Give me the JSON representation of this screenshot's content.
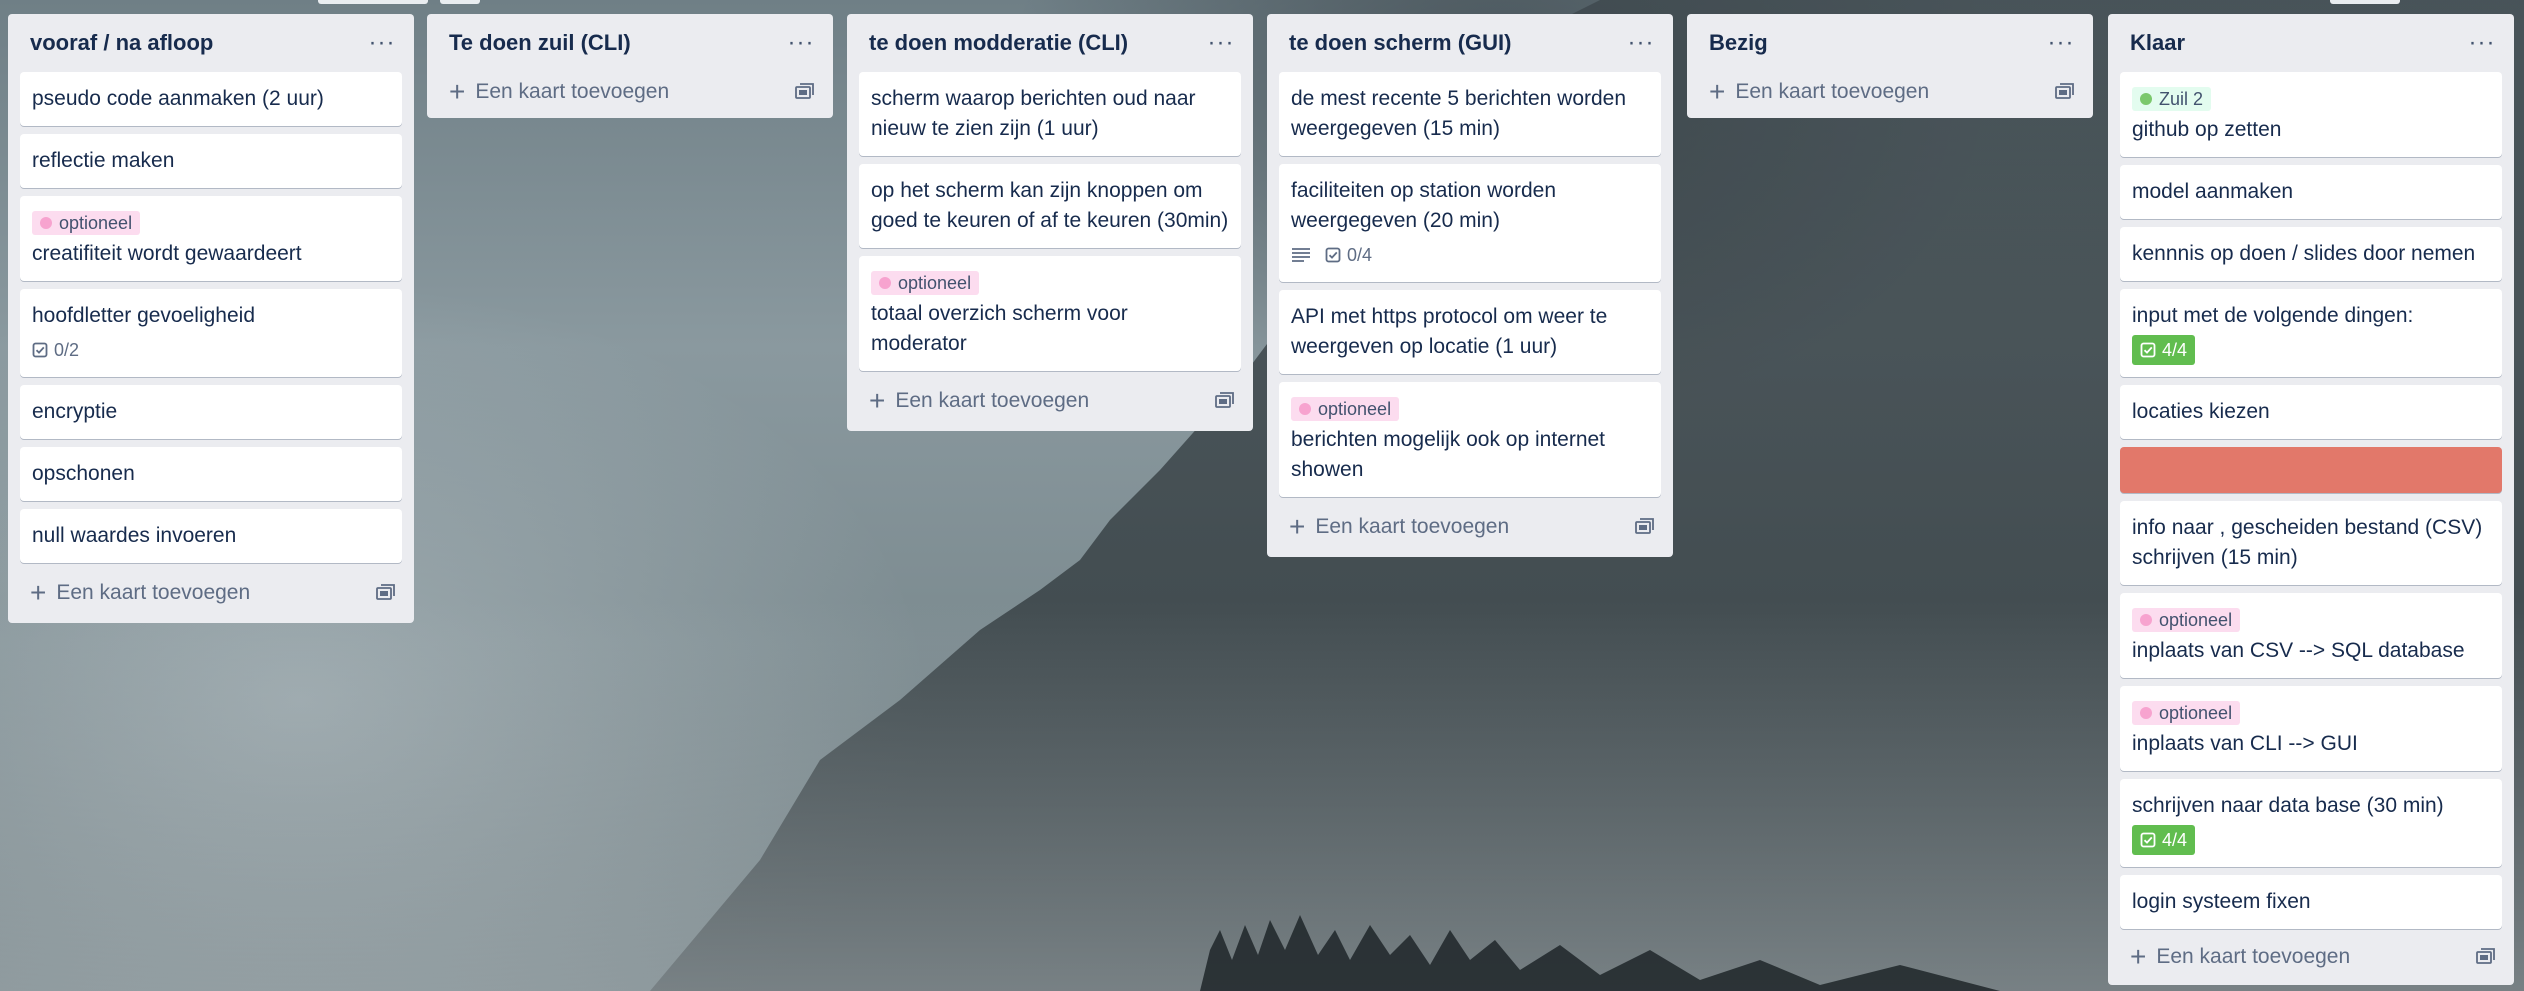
{
  "add_card_label": "Een kaart toevoegen",
  "menu_glyph": "···",
  "colors": {
    "label_pink": "#f7a3cf",
    "label_green": "#7bc86c",
    "cover_orange": "#e2786a",
    "checklist_done": "#61bd4f"
  },
  "lists": [
    {
      "title": "vooraf / na afloop",
      "cards": [
        {
          "title": "pseudo code aanmaken (2 uur)"
        },
        {
          "title": "reflectie maken"
        },
        {
          "label": "optioneel",
          "title": "creatifiteit wordt gewaardeert"
        },
        {
          "title": "hoofdletter gevoeligheid",
          "checklist": "0/2"
        },
        {
          "title": "encryptie"
        },
        {
          "title": "opschonen"
        },
        {
          "title": "null waardes invoeren"
        }
      ]
    },
    {
      "title": "Te doen zuil (CLI)",
      "cards": []
    },
    {
      "title": "te doen modderatie (CLI)",
      "cards": [
        {
          "title": "scherm waarop berichten oud naar nieuw te zien zijn (1 uur)"
        },
        {
          "title": "op het scherm kan zijn knoppen om goed te keuren of af te keuren (30min)"
        },
        {
          "label": "optioneel",
          "title": "totaal overzich scherm voor moderator"
        }
      ]
    },
    {
      "title": "te doen scherm (GUI)",
      "cards": [
        {
          "title": "de mest recente 5 berichten worden weergegeven (15 min)"
        },
        {
          "title": "faciliteiten op station worden weergegeven (20 min)",
          "checklist": "0/4"
        },
        {
          "title": "API met https protocol om weer te weergeven op locatie (1 uur)"
        },
        {
          "label": "optioneel",
          "title": "berichten mogelijk ook op internet showen"
        }
      ]
    },
    {
      "title": "Bezig",
      "cards": []
    },
    {
      "title": "Klaar",
      "cards": [
        {
          "label": "Zuil 2",
          "title": "github op zetten"
        },
        {
          "title": "model aanmaken"
        },
        {
          "title": "kennnis op doen / slides door nemen"
        },
        {
          "title": "input met de volgende dingen:",
          "checklist": "4/4"
        },
        {
          "title": "locaties kiezen"
        },
        {
          "title": ""
        },
        {
          "title": "info naar , gescheiden bestand (CSV) schrijven (15 min)"
        },
        {
          "label": "optioneel",
          "title": "inplaats van CSV --> SQL database"
        },
        {
          "label": "optioneel",
          "title": "inplaats van CLI --> GUI"
        },
        {
          "title": "schrijven naar data base (30 min)",
          "checklist": "4/4"
        },
        {
          "title": "login systeem fixen"
        }
      ]
    }
  ]
}
